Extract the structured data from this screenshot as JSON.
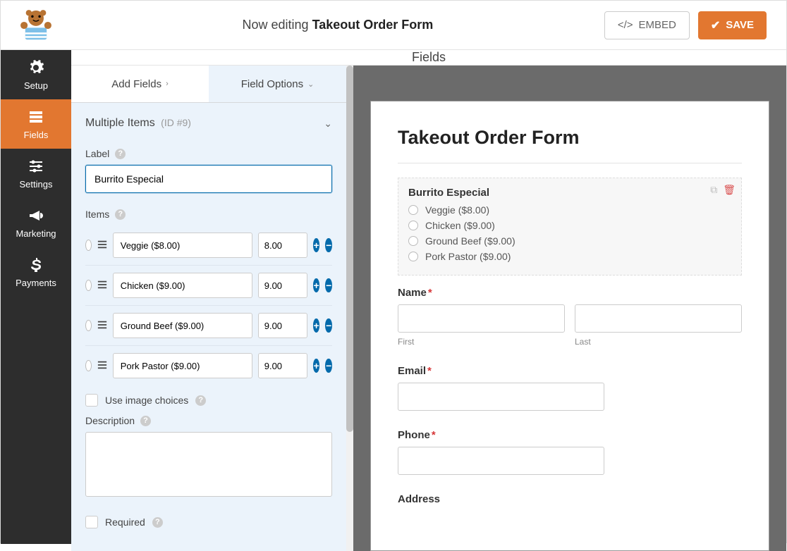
{
  "header": {
    "editing_prefix": "Now editing",
    "form_name": "Takeout Order Form",
    "embed_label": "EMBED",
    "save_label": "SAVE"
  },
  "sidebar": {
    "items": [
      {
        "label": "Setup"
      },
      {
        "label": "Fields"
      },
      {
        "label": "Settings"
      },
      {
        "label": "Marketing"
      },
      {
        "label": "Payments"
      }
    ]
  },
  "panel": {
    "header": "Fields",
    "tabs": {
      "add": "Add Fields",
      "options": "Field Options"
    },
    "section_title": "Multiple Items",
    "section_id": "(ID #9)",
    "label_heading": "Label",
    "label_value": "Burrito Especial",
    "items_heading": "Items",
    "items": [
      {
        "name": "Veggie ($8.00)",
        "price": "8.00"
      },
      {
        "name": "Chicken ($9.00)",
        "price": "9.00"
      },
      {
        "name": "Ground Beef ($9.00)",
        "price": "9.00"
      },
      {
        "name": "Pork Pastor ($9.00)",
        "price": "9.00"
      }
    ],
    "use_image_choices": "Use image choices",
    "description_heading": "Description",
    "required_label": "Required"
  },
  "preview": {
    "title": "Takeout Order Form",
    "field_title": "Burrito Especial",
    "options": [
      "Veggie ($8.00)",
      "Chicken ($9.00)",
      "Ground Beef ($9.00)",
      "Pork Pastor ($9.00)"
    ],
    "name_label": "Name",
    "first": "First",
    "last": "Last",
    "email_label": "Email",
    "phone_label": "Phone",
    "address_label": "Address",
    "required_marker": "*"
  }
}
